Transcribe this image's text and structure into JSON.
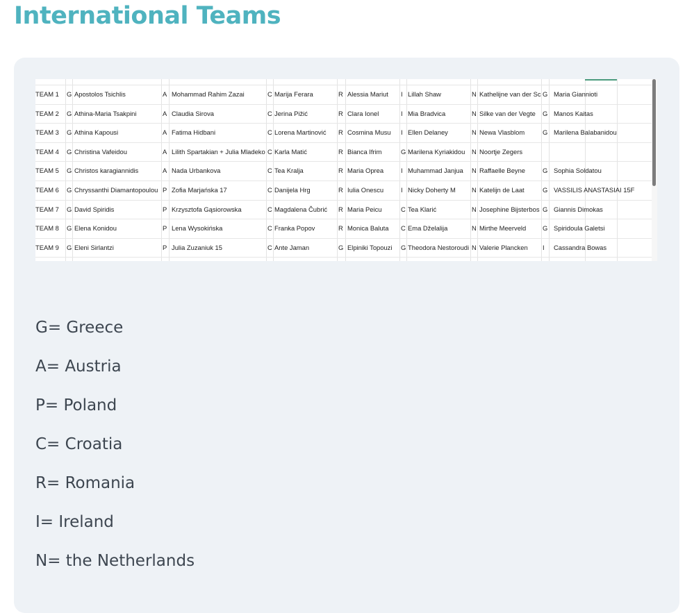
{
  "page": {
    "title": "International Teams",
    "accent_color": "#4fb3bf",
    "panel_color": "#eef2f6"
  },
  "spreadsheet": {
    "rows": [
      [
        "TEAM 1",
        "G",
        "Apostolos Tsichlis",
        "A",
        "Mohammad Rahim Zazai",
        "C",
        "Marija  Ferara",
        "R",
        "Alessia Mariut",
        "I",
        "Lillah Shaw",
        "N",
        "Kathelijne van der Sc",
        "G",
        "Maria Giannioti"
      ],
      [
        "TEAM 2",
        "G",
        "Athina-Maria Tsakpini",
        "A",
        "Claudia Sirova",
        "C",
        "Jerina Pižić",
        "R",
        "Clara Ionel",
        "I",
        "Mia Bradvica",
        "N",
        "Silke van der Vegte",
        "G",
        "Manos Kaitas"
      ],
      [
        "TEAM 3",
        "G",
        "Athina Kapousi",
        "A",
        "Fatima Hidbani",
        "C",
        "Lorena Martinović",
        "R",
        "Cosmina Musu",
        "I",
        "Ellen Delaney",
        "N",
        "Newa Vlasblom",
        "G",
        "Marilena Balabanidou"
      ],
      [
        "TEAM 4",
        "G",
        "Christina Vafeidou",
        "A",
        "Lilith Spartakian + Julia Mladeko",
        "C",
        "Karla Matić",
        "R",
        "Bianca Ifrim",
        "G",
        "Marilena Kyriakidou",
        "N",
        "Noortje Zegers",
        "",
        ""
      ],
      [
        "TEAM 5",
        "G",
        "Christos karagiannidis",
        "A",
        "Nada Urbankova",
        "C",
        "Tea Kralja",
        "R",
        "Maria Oprea",
        "I",
        "Muhammad Janjua",
        "N",
        "Raffaelle Beyne",
        "G",
        "Sophia Soldatou"
      ],
      [
        "TEAM 6",
        "G",
        "Chryssanthi Diamantopoulou",
        "P",
        "Zofia Marjańska 17",
        "C",
        "Danijela Hrg",
        "R",
        "Iulia Onescu",
        "I",
        "Nicky Doherty M",
        "N",
        "Katelijn de Laat",
        "G",
        "VASSILIS ANASTASIAI 15F"
      ],
      [
        "TEAM 7",
        "G",
        "David Spiridis",
        "P",
        "Krzysztofa Gąsiorowska",
        "C",
        "Magdalena Čubrić",
        "R",
        "Maria Peicu",
        "C",
        "Tea Klarić",
        "N",
        "Josephine Bijsterbos",
        "G",
        "Giannis Dimokas"
      ],
      [
        "TEAM 8",
        "G",
        "Elena Konidou",
        "P",
        "Lena Wysokińska",
        "C",
        "Franka Popov",
        "R",
        "Monica Baluta",
        "C",
        "Ema Dželalija",
        "N",
        "Mirthe Meerveld",
        "G",
        "Spiridoula Galetsi"
      ],
      [
        "TEAM 9",
        "G",
        "Eleni Sirlantzi",
        "P",
        "Julia Zuzaniuk 15",
        "C",
        "Ante Jaman",
        "G",
        "Elpiniki Topouzi",
        "G",
        "Theodora Nestoroudi",
        "N",
        "Valerie Plancken",
        "I",
        "Cassandra Bowas"
      ]
    ]
  },
  "legend": [
    "G= Greece",
    "A= Austria",
    "P= Poland",
    "C= Croatia",
    "R= Romania",
    "I= Ireland",
    "N= the Netherlands"
  ]
}
